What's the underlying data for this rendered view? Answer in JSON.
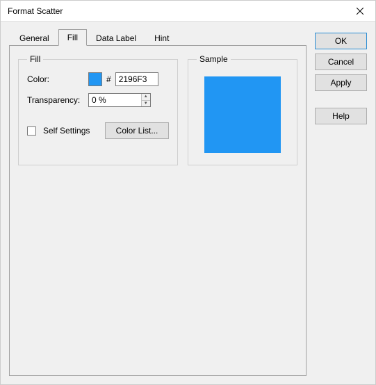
{
  "window": {
    "title": "Format Scatter"
  },
  "tabs": {
    "general": "General",
    "fill": "Fill",
    "dataLabel": "Data Label",
    "hint": "Hint",
    "active": "fill"
  },
  "fill": {
    "legend": "Fill",
    "colorLabel": "Color:",
    "colorHex": "2196F3",
    "hash": "#",
    "transparencyLabel": "Transparency:",
    "transparencyValue": "0 %",
    "selfSettingsLabel": "Self Settings",
    "selfSettingsChecked": false,
    "colorListLabel": "Color List..."
  },
  "sample": {
    "legend": "Sample",
    "colorHex": "2196F3"
  },
  "buttons": {
    "ok": "OK",
    "cancel": "Cancel",
    "apply": "Apply",
    "help": "Help"
  },
  "colors": {
    "swatch": "#2196F3",
    "sample": "#2196F3"
  }
}
